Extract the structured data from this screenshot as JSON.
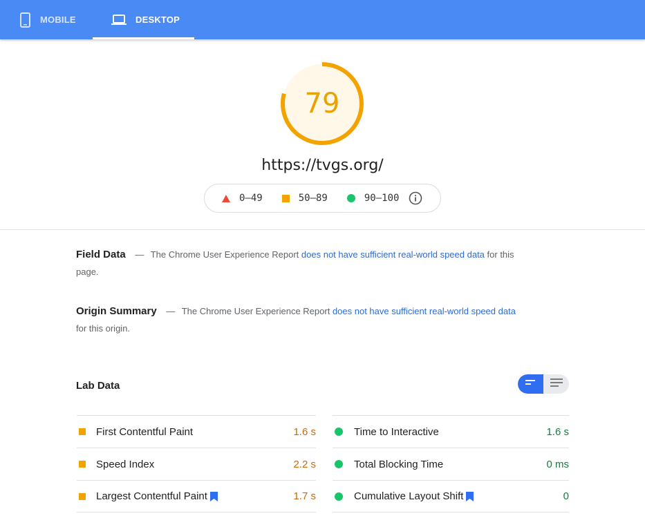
{
  "tabs": [
    {
      "label": "MOBILE",
      "active": false,
      "icon": "phone-icon"
    },
    {
      "label": "DESKTOP",
      "active": true,
      "icon": "laptop-icon"
    }
  ],
  "score": {
    "value": "79",
    "fraction": 0.79,
    "color": "#f3a300",
    "background": "#fff7e8"
  },
  "url": "https://tvgs.org/",
  "legend": {
    "fail": "0–49",
    "average": "50–89",
    "pass": "90–100"
  },
  "field_data": {
    "heading": "Field Data",
    "dash": "—",
    "text_before": "The Chrome User Experience Report",
    "link": "does not have sufficient real-world speed data",
    "text_after": "for this page."
  },
  "origin_summary": {
    "heading": "Origin Summary",
    "dash": "—",
    "text_before": "The Chrome User Experience Report",
    "link": "does not have sufficient real-world speed data",
    "text_after": "for this origin."
  },
  "lab_data": {
    "title": "Lab Data",
    "left": [
      {
        "label": "First Contentful Paint",
        "value": "1.6 s",
        "status": "average"
      },
      {
        "label": "Speed Index",
        "value": "2.2 s",
        "status": "average"
      },
      {
        "label": "Largest Contentful Paint",
        "value": "1.7 s",
        "status": "average",
        "bookmark": true
      }
    ],
    "right": [
      {
        "label": "Time to Interactive",
        "value": "1.6 s",
        "status": "pass"
      },
      {
        "label": "Total Blocking Time",
        "value": "0 ms",
        "status": "pass"
      },
      {
        "label": "Cumulative Layout Shift",
        "value": "0",
        "status": "pass",
        "bookmark": true
      }
    ]
  }
}
